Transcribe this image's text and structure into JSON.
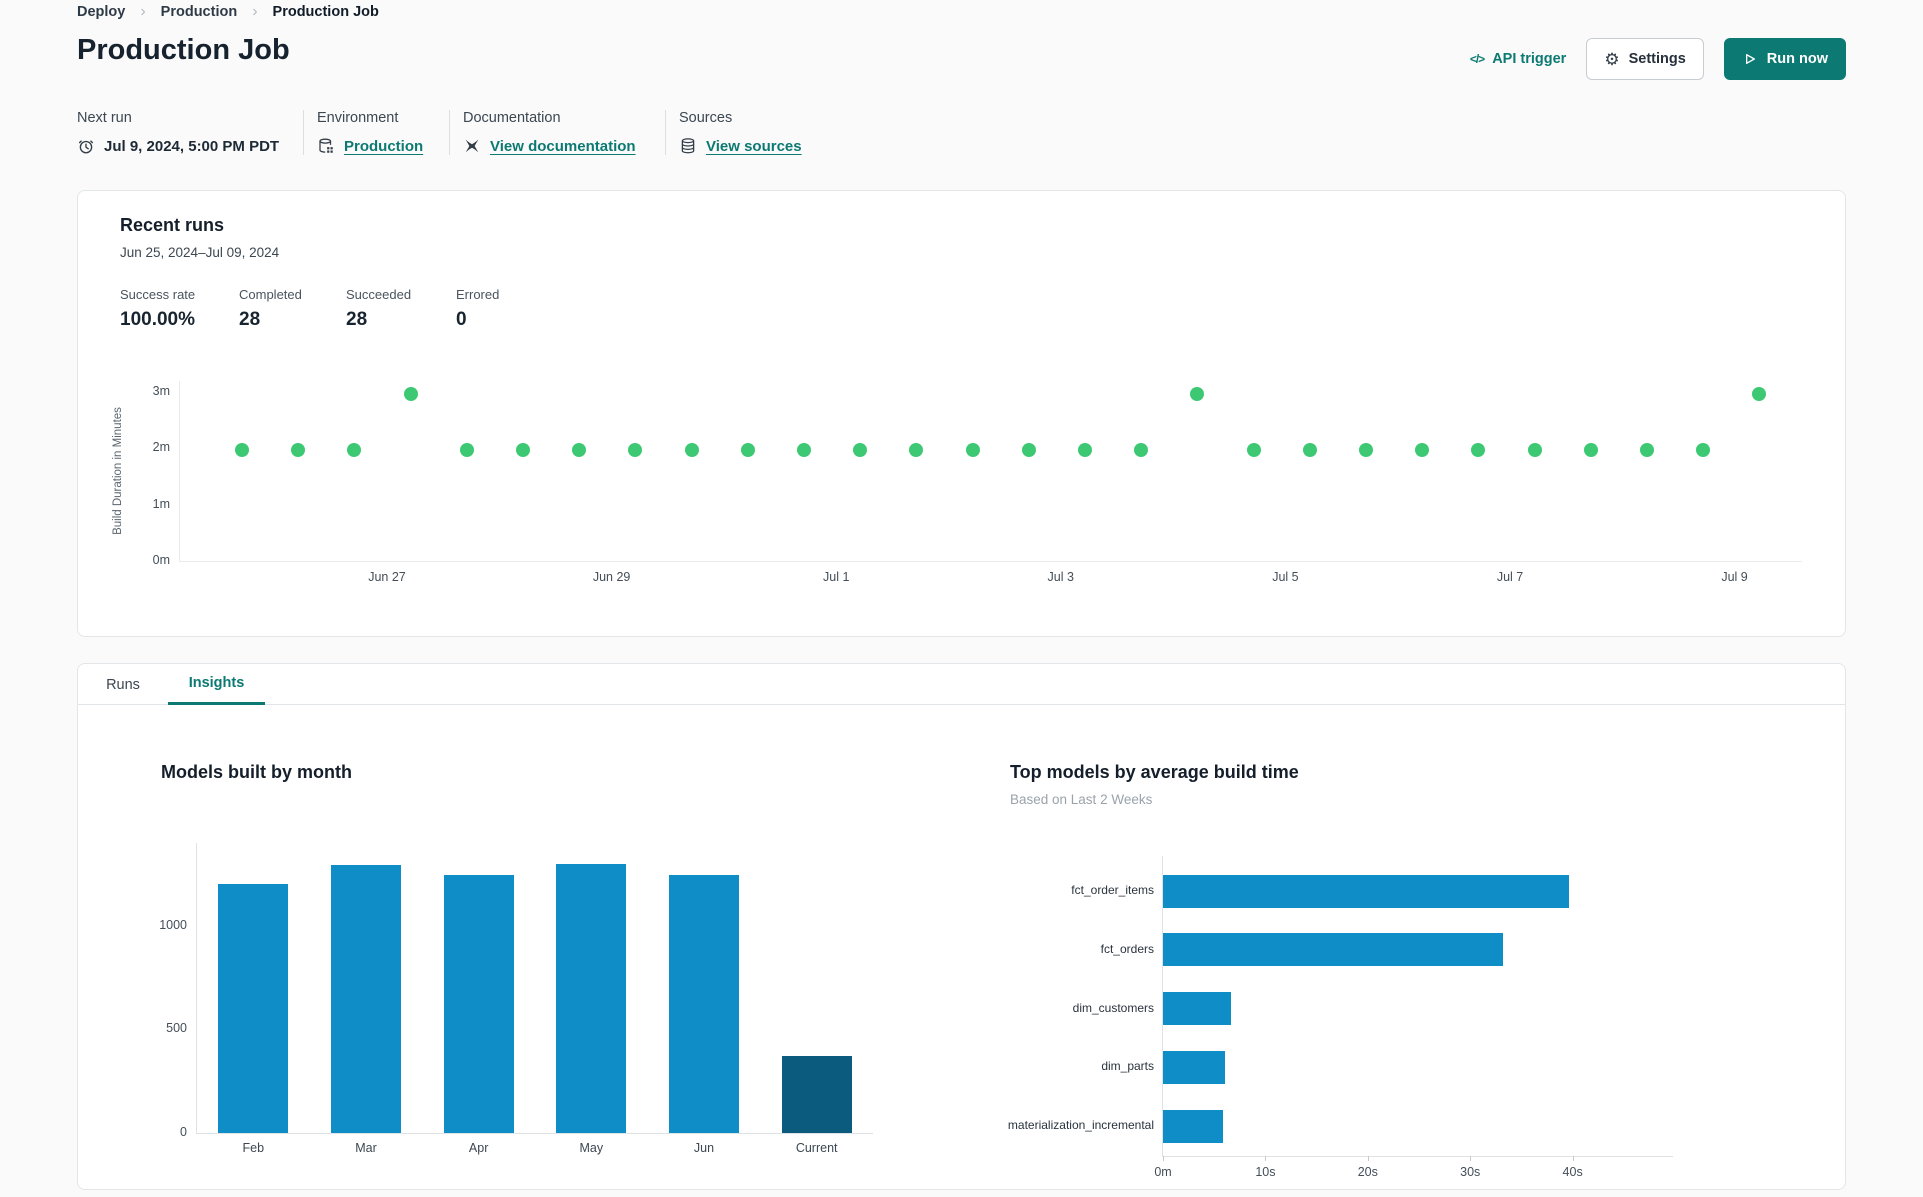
{
  "breadcrumb": {
    "items": [
      "Deploy",
      "Production",
      "Production Job"
    ]
  },
  "icons": {
    "separator": "›",
    "code": "</>",
    "gear": "⚙"
  },
  "header": {
    "title": "Production Job",
    "api_trigger_label": "API trigger",
    "settings_label": "Settings",
    "run_now_label": "Run now"
  },
  "meta": {
    "next_run": {
      "label": "Next run",
      "value": "Jul 9, 2024, 5:00 PM PDT",
      "icon": "alarm-clock-icon"
    },
    "environment": {
      "label": "Environment",
      "value": "Production",
      "icon": "environment-database-icon"
    },
    "documentation": {
      "label": "Documentation",
      "value": "View documentation",
      "icon": "dbt-docs-icon"
    },
    "sources": {
      "label": "Sources",
      "value": "View sources",
      "icon": "sources-database-icon"
    }
  },
  "recent_runs": {
    "title": "Recent runs",
    "date_range": "Jun 25, 2024–Jul 09, 2024",
    "stats": [
      {
        "label": "Success rate",
        "value": "100.00%"
      },
      {
        "label": "Completed",
        "value": "28"
      },
      {
        "label": "Succeeded",
        "value": "28"
      },
      {
        "label": "Errored",
        "value": "0"
      }
    ]
  },
  "tabs": [
    {
      "label": "Runs",
      "active": false
    },
    {
      "label": "Insights",
      "active": true
    }
  ],
  "colors": {
    "accent_teal": "#0c7a72",
    "dot_green": "#3dc973",
    "bar_blue": "#0f8dc7",
    "bar_dark_blue": "#0b5b7e"
  },
  "chart_data": [
    {
      "type": "scatter",
      "title": "Recent runs build durations",
      "ylabel": "Build Duration in Minutes",
      "yticks": [
        {
          "label": "0m",
          "value": 0
        },
        {
          "label": "1m",
          "value": 1
        },
        {
          "label": "2m",
          "value": 2
        },
        {
          "label": "3m",
          "value": 3
        }
      ],
      "ylim": [
        0,
        3.19
      ],
      "xticks": [
        {
          "label": "Jun 27",
          "frac": 0.1276
        },
        {
          "label": "Jun 29",
          "frac": 0.2661
        },
        {
          "label": "Jul 1",
          "frac": 0.4046
        },
        {
          "label": "Jul 3",
          "frac": 0.543
        },
        {
          "label": "Jul 5",
          "frac": 0.6815
        },
        {
          "label": "Jul 7",
          "frac": 0.82
        },
        {
          "label": "Jul 9",
          "frac": 0.9584
        }
      ],
      "values": [
        1.97,
        1.97,
        1.97,
        2.95,
        1.97,
        1.97,
        1.97,
        1.97,
        1.97,
        1.97,
        1.97,
        1.97,
        1.97,
        1.97,
        1.97,
        1.97,
        1.97,
        2.95,
        1.97,
        1.97,
        1.97,
        1.97,
        1.97,
        1.97,
        1.97,
        1.97,
        1.97,
        2.95
      ],
      "point_color": "#3dc973",
      "grid": false,
      "legend": "none"
    },
    {
      "type": "bar",
      "title": "Models built by month",
      "categories": [
        "Feb",
        "Mar",
        "Apr",
        "May",
        "Jun",
        "Current"
      ],
      "values": [
        1200,
        1295,
        1245,
        1300,
        1245,
        370
      ],
      "yticks": [
        0,
        500,
        1000
      ],
      "ylim": [
        0,
        1400
      ],
      "xlabel": "",
      "ylabel": "",
      "bar_colors": [
        "#0f8dc7",
        "#0f8dc7",
        "#0f8dc7",
        "#0f8dc7",
        "#0f8dc7",
        "#0b5b7e"
      ],
      "grid": false,
      "legend": "none"
    },
    {
      "type": "barh",
      "title": "Top models by average build time",
      "subtitle": "Based on Last 2 Weeks",
      "categories": [
        "fct_order_items",
        "fct_orders",
        "dim_customers",
        "dim_parts",
        "materialization_incremental"
      ],
      "values": [
        39.6,
        33.2,
        6.6,
        6.1,
        5.9
      ],
      "xticks": [
        {
          "label": "0m",
          "value": 0
        },
        {
          "label": "10s",
          "value": 10
        },
        {
          "label": "20s",
          "value": 20
        },
        {
          "label": "30s",
          "value": 30
        },
        {
          "label": "40s",
          "value": 40
        }
      ],
      "xlim": [
        0,
        49.8
      ],
      "bar_color": "#0f8dc7",
      "grid": false,
      "legend": "none"
    }
  ]
}
